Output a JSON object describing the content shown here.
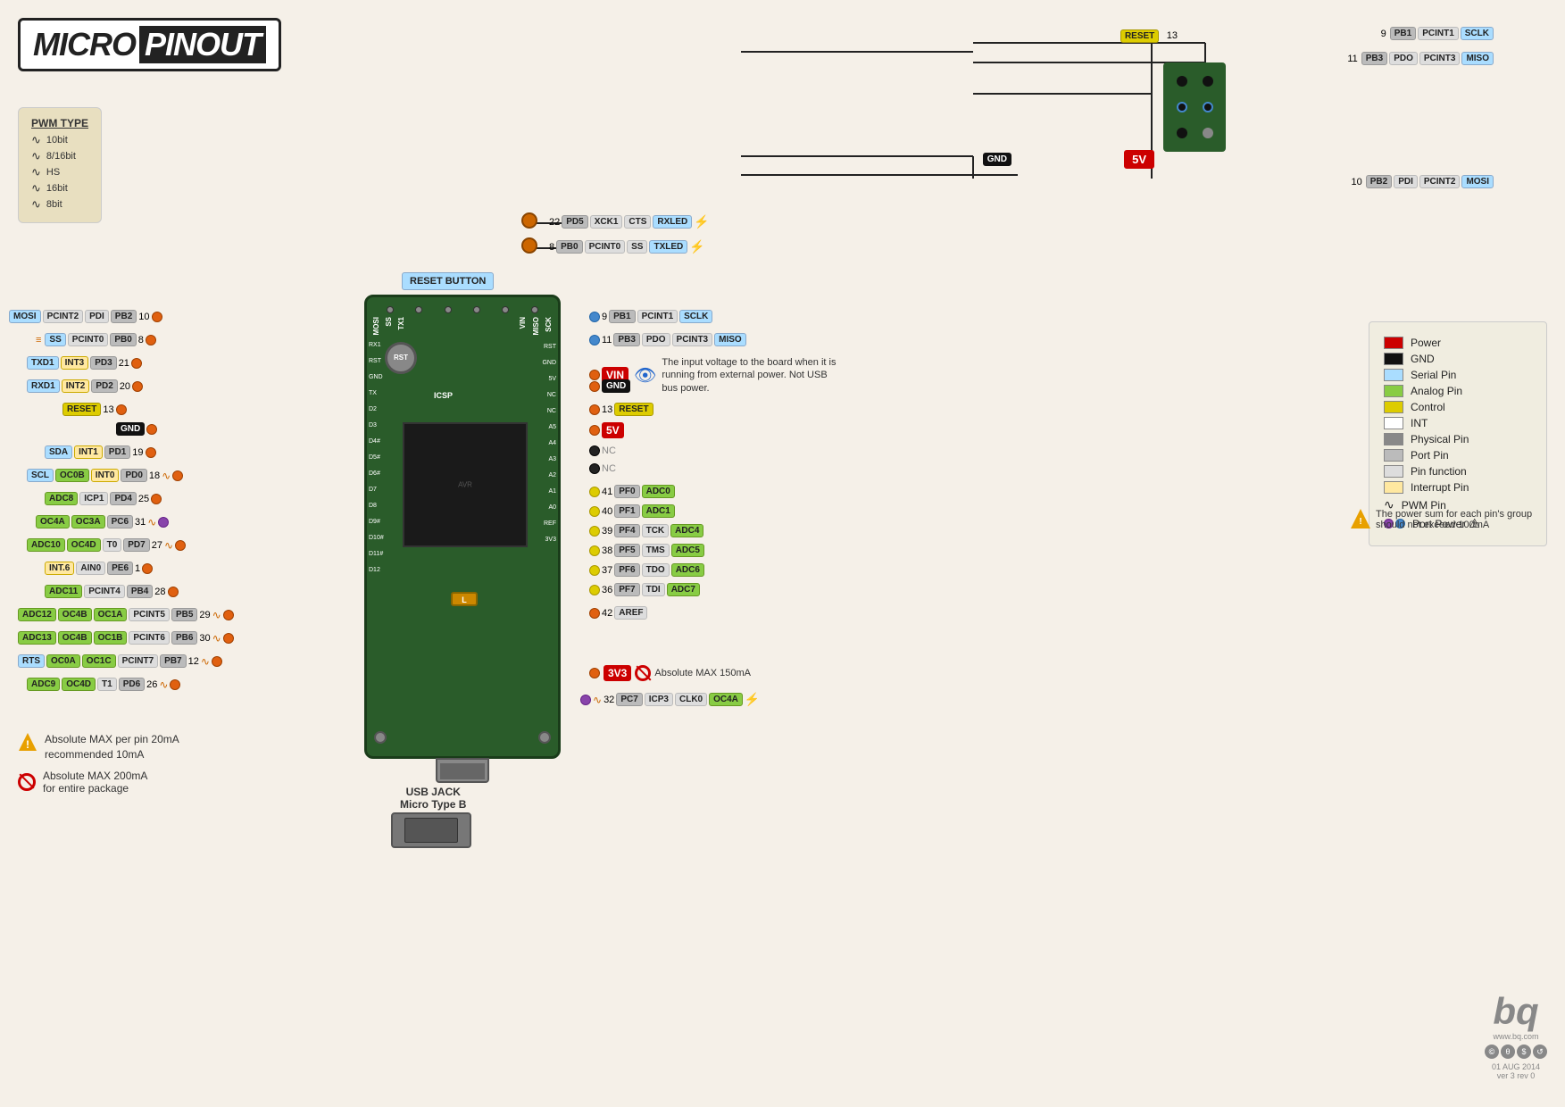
{
  "title": {
    "micro": "MICRO",
    "pinout": "PINOUT"
  },
  "pwm_legend": {
    "title": "PWM TYPE",
    "items": [
      {
        "wave": "∿",
        "label": "10bit"
      },
      {
        "wave": "∿",
        "label": "8/16bit"
      },
      {
        "wave": "∿",
        "label": "HS"
      },
      {
        "wave": "∿",
        "label": "16bit"
      },
      {
        "wave": "∿",
        "label": "8bit"
      }
    ]
  },
  "color_legend": {
    "items": [
      {
        "color": "#cc0000",
        "label": "Power"
      },
      {
        "color": "#111111",
        "label": "GND"
      },
      {
        "color": "#aaddff",
        "label": "Serial Pin"
      },
      {
        "color": "#88cc44",
        "label": "Analog Pin"
      },
      {
        "color": "#ddcc00",
        "label": "Control"
      },
      {
        "color": "#ffffff",
        "label": "INT"
      },
      {
        "color": "#888888",
        "label": "Physical Pin"
      },
      {
        "color": "#bbbbbb",
        "label": "Port Pin"
      },
      {
        "color": "#dddddd",
        "label": "Pin function"
      },
      {
        "color": "#ffe8a0",
        "label": "Interrupt Pin"
      },
      {
        "wave": true,
        "label": "PWM Pin"
      },
      {
        "port_power": true,
        "label": "Port Power"
      }
    ]
  },
  "labels": {
    "reset_button": "RESET BUTTON",
    "usb_jack": "USB JACK",
    "micro_type_b": "Micro Type B",
    "icsp": "ICSP",
    "vin_description": "The input voltage to the board when it is running from external power. Not USB bus power.",
    "v3v3_warning": "Absolute MAX 150mA",
    "warning1_line1": "Absolute MAX per pin 20mA",
    "warning1_line2": "recommended 10mA",
    "warning2": "Absolute MAX 200mA for entire package",
    "port_power_note": "The power sum for each pin's group should not exceed 100mA",
    "bq_url": "www.bq.com",
    "bq_date": "01 AUG 2014",
    "bq_ver": "ver 3 rev 0"
  },
  "top_right_pins": {
    "reset_label": "RESET",
    "reset_num": "13",
    "pins": [
      {
        "num": "9",
        "port": "PB1",
        "func1": "PCINT1",
        "func2": "SCLK"
      },
      {
        "num": "11",
        "port": "PB3",
        "func1": "PDO",
        "func2": "PCINT3",
        "func3": "MISO"
      },
      {
        "num": "10",
        "port": "PB2",
        "func1": "PDI",
        "func2": "PCINT2",
        "func3": "MOSI"
      }
    ],
    "gnd": "GND",
    "v5": "5V"
  },
  "top_leds": [
    {
      "num": "22",
      "port": "PD5",
      "func1": "XCK1",
      "func2": "CTS",
      "func3": "RXLED"
    },
    {
      "num": "8",
      "port": "PB0",
      "func1": "PCINT0",
      "func2": "SS",
      "func3": "TXLED"
    }
  ],
  "left_pins": [
    {
      "num": "10",
      "port": "PB2",
      "func1": "PDI",
      "func2": "PCINT2",
      "func3": "MOSI",
      "dot": "orange"
    },
    {
      "num": "8",
      "port": "PB0",
      "func1": "PCINT0",
      "func2": "SS",
      "dot": "orange",
      "extra": "SS"
    },
    {
      "num": "21",
      "port": "PD3",
      "func1": "INT3",
      "func2": "TXD1",
      "dot": "orange"
    },
    {
      "num": "20",
      "port": "PD2",
      "func1": "INT2",
      "func2": "RXD1",
      "dot": "orange"
    },
    {
      "num": "13",
      "label": "RESET",
      "dot": "orange"
    },
    {
      "gnd": true,
      "dot": "orange"
    },
    {
      "num": "19",
      "port": "PD1",
      "func1": "INT1",
      "func2": "SDA",
      "dot": "orange"
    },
    {
      "num": "18",
      "port": "PD0",
      "func1": "INT0",
      "func2": "OC0B",
      "func3": "SCL",
      "dot": "orange",
      "pwm": true
    },
    {
      "num": "25",
      "port": "PD4",
      "func1": "ICP1",
      "func2": "ADC8",
      "dot": "orange"
    },
    {
      "num": "31",
      "port": "PC6",
      "func1": "OC3A",
      "func2": "OC4A",
      "dot": "purple",
      "pwm": true
    },
    {
      "num": "27",
      "port": "PD7",
      "func1": "T0",
      "func2": "OC4D",
      "func3": "ADC10",
      "dot": "orange",
      "pwm": true
    },
    {
      "num": "1",
      "port": "PE6",
      "func1": "AIN0",
      "func2": "INT.6",
      "dot": "orange"
    },
    {
      "num": "28",
      "port": "PB4",
      "func1": "PCINT4",
      "func2": "ADC11",
      "dot": "orange"
    },
    {
      "num": "29",
      "port": "PB5",
      "func1": "PCINT5",
      "func2": "OC1A",
      "func3": "OC4B",
      "func4": "ADC12",
      "dot": "orange",
      "pwm": true
    },
    {
      "num": "30",
      "port": "PB6",
      "func1": "PCINT6",
      "func2": "OC1B",
      "func3": "OC4B",
      "func4": "ADC13",
      "dot": "orange",
      "pwm": true
    },
    {
      "num": "12",
      "port": "PB7",
      "func1": "PCINT7",
      "func2": "OC0A",
      "func3": "OC1C",
      "func4": "RTS",
      "dot": "orange",
      "pwm": true
    },
    {
      "num": "26",
      "port": "PD6",
      "func1": "T1",
      "func2": "OC4D",
      "func3": "ADC9",
      "dot": "orange",
      "pwm": true
    }
  ],
  "right_pins": [
    {
      "num": "9",
      "port": "PB1",
      "func1": "PCINT1",
      "func2": "SCLK",
      "dot": "blue"
    },
    {
      "num": "11",
      "port": "PB3",
      "func1": "PDO",
      "func2": "PCINT3",
      "func3": "MISO",
      "dot": "blue"
    },
    {
      "label": "VIN",
      "power": true,
      "dot": "orange"
    },
    {
      "label": "GND",
      "gnd": true,
      "dot": "orange"
    },
    {
      "num": "13",
      "label": "RESET",
      "control": true,
      "dot": "orange"
    },
    {
      "label": "5V",
      "power": true,
      "dot": "orange"
    },
    {
      "label": "NC",
      "nc": true
    },
    {
      "label": "NC",
      "nc": true
    },
    {
      "num": "41",
      "port": "PF0",
      "func1": "ADC0",
      "dot": "yellow"
    },
    {
      "num": "40",
      "port": "PF1",
      "func1": "ADC1",
      "dot": "yellow"
    },
    {
      "num": "39",
      "port": "PF4",
      "func1": "TCK",
      "func2": "ADC4",
      "dot": "yellow"
    },
    {
      "num": "38",
      "port": "PF5",
      "func1": "TMS",
      "func2": "ADC5",
      "dot": "yellow"
    },
    {
      "num": "37",
      "port": "PF6",
      "func1": "TDO",
      "func2": "ADC6",
      "dot": "yellow"
    },
    {
      "num": "36",
      "port": "PF7",
      "func1": "TDI",
      "func2": "ADC7",
      "dot": "yellow"
    },
    {
      "num": "42",
      "label": "AREF",
      "dot": "orange"
    },
    {
      "label": "3V3",
      "power": true,
      "dot": "orange"
    },
    {
      "num": "32",
      "port": "PC7",
      "func1": "ICP3",
      "func2": "CLK0",
      "func3": "OC4A",
      "dot": "purple",
      "pwm": true
    }
  ]
}
